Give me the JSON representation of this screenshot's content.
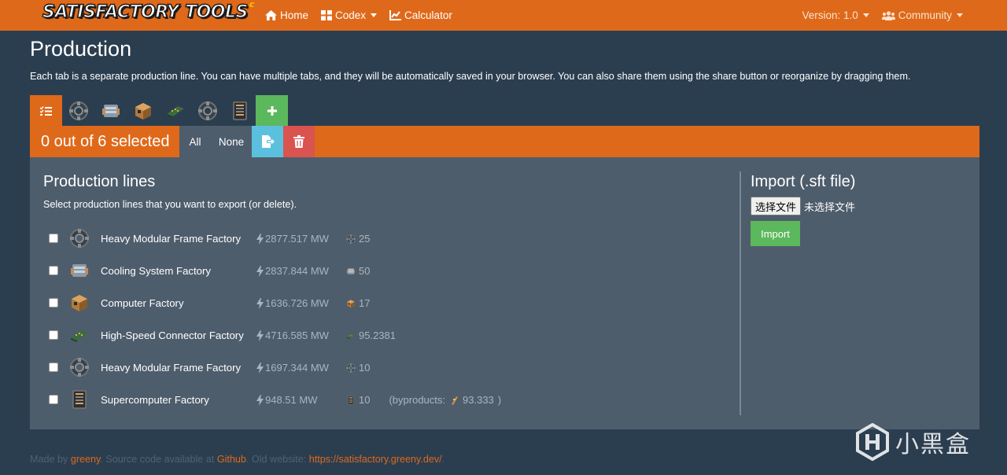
{
  "brand": {
    "logo_text_1": "SATISFACTORY",
    "logo_text_2": "TOOLS",
    "logo_mark": "c"
  },
  "nav": {
    "home": "Home",
    "codex": "Codex",
    "calculator": "Calculator",
    "version": "Version: 1.0",
    "community": "Community"
  },
  "page": {
    "title": "Production",
    "intro": "Each tab is a separate production line. You can have multiple tabs, and they will be automatically saved in your browser. You can also share them using the share button or reorganize by dragging them."
  },
  "tabs": [
    {
      "icon": "list-check-icon"
    },
    {
      "icon": "heavy-modular-frame-icon"
    },
    {
      "icon": "cooling-system-icon"
    },
    {
      "icon": "computer-icon"
    },
    {
      "icon": "high-speed-connector-icon"
    },
    {
      "icon": "heavy-modular-frame-icon"
    },
    {
      "icon": "supercomputer-icon"
    },
    {
      "icon": "plus-icon"
    }
  ],
  "toolbar": {
    "selection": "0 out of 6 selected",
    "all": "All",
    "none": "None"
  },
  "production": {
    "title": "Production lines",
    "subtitle": "Select production lines that you want to export (or delete).",
    "rows": [
      {
        "name": "Heavy Modular Frame Factory",
        "power": "2877.517 MW",
        "amount": "25",
        "icon": "heavy-modular-frame"
      },
      {
        "name": "Cooling System Factory",
        "power": "2837.844 MW",
        "amount": "50",
        "icon": "cooling-system"
      },
      {
        "name": "Computer Factory",
        "power": "1636.726 MW",
        "amount": "17",
        "icon": "computer"
      },
      {
        "name": "High-Speed Connector Factory",
        "power": "4716.585 MW",
        "amount": "95.2381",
        "icon": "high-speed-connector"
      },
      {
        "name": "Heavy Modular Frame Factory",
        "power": "1697.344 MW",
        "amount": "10",
        "icon": "heavy-modular-frame"
      },
      {
        "name": "Supercomputer Factory",
        "power": "948.51 MW",
        "amount": "10",
        "icon": "supercomputer",
        "byproducts_label": "(byproducts:",
        "byproduct_amount": "93.333",
        "byproducts_close": ")"
      }
    ]
  },
  "import": {
    "title": "Import (.sft file)",
    "choose_file": "选择文件",
    "no_file": "未选择文件",
    "button": "Import"
  },
  "footer": {
    "made_by": "Made by ",
    "author": "greeny",
    "source": ". Source code available at ",
    "github": "Github",
    "old": ". Old website: ",
    "old_url": "https://satisfactory.greeny.dev/",
    "end": "."
  },
  "watermark": {
    "text": "小黑盒"
  },
  "colors": {
    "accent": "#df691a",
    "bg": "#2b3e50",
    "panel": "#4e5d6c",
    "success": "#5cb85c",
    "info": "#5bc0de",
    "danger": "#d9534f"
  }
}
